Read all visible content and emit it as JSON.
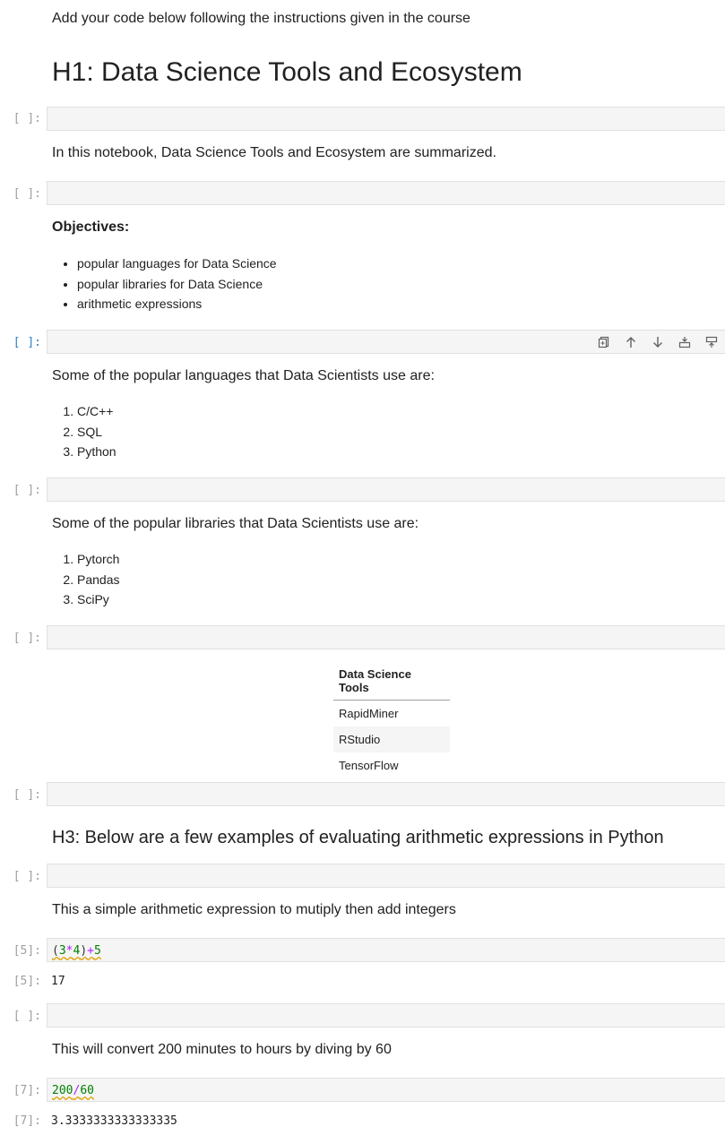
{
  "cells": {
    "intro_text": "Add your code below following the instructions given in the course",
    "h1_title": "H1: Data Science Tools and Ecosystem",
    "summary_text": "In this notebook, Data Science Tools and Ecosystem are summarized.",
    "objectives_heading": "Objectives:",
    "objectives": [
      "popular languages for Data Science",
      "popular libraries for Data Science",
      "arithmetic expressions"
    ],
    "languages_intro": "Some of the popular languages that Data Scientists use are:",
    "languages": [
      "C/C++",
      "SQL",
      "Python"
    ],
    "libraries_intro": "Some of the popular libraries that Data Scientists use are:",
    "libraries": [
      "Pytorch",
      "Pandas",
      "SciPy"
    ],
    "tools_table": {
      "header": "Data Science Tools",
      "rows": [
        "RapidMiner",
        "RStudio",
        "TensorFlow"
      ]
    },
    "h3_title": "H3: Below are a few examples of evaluating arithmetic expressions in Python",
    "mult_add_text": "This a simple arithmetic expression to mutiply then add integers",
    "convert_text": "This will convert 200 minutes to hours by diving by 60"
  },
  "prompts": {
    "empty": "[ ]:",
    "exec5": "[5]:",
    "exec7": "[7]:"
  },
  "code": {
    "cell5": {
      "p1": "(",
      "n1": "3",
      "o1": "*",
      "n2": "4",
      "p2": ")",
      "o2": "+",
      "n3": "5"
    },
    "cell7": {
      "n1": "200",
      "o1": "/",
      "n2": "60"
    }
  },
  "outputs": {
    "out5": "17",
    "out7": "3.3333333333333335"
  },
  "toolbar": {
    "icons": [
      "duplicate-icon",
      "move-up-icon",
      "move-down-icon",
      "insert-above-icon",
      "insert-below-icon"
    ]
  },
  "colors": {
    "active_prompt": "#307fc1",
    "prompt": "#9e9e9e",
    "code_bg": "#f5f5f5",
    "number": "#008000",
    "operator": "#aa22ff"
  }
}
